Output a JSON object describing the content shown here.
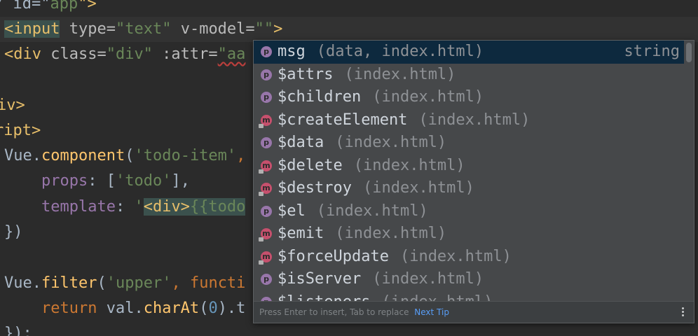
{
  "code_lines": [
    {
      "tokens": [
        {
          "t": "/ id=\"",
          "c": "plain"
        },
        {
          "t": "app",
          "c": "str"
        },
        {
          "t": "\">",
          "c": "tag"
        }
      ]
    },
    {
      "tokens": [
        {
          "t": "<input",
          "c": "tag"
        },
        {
          "t": " type=",
          "c": "attr"
        },
        {
          "t": "\"text\"",
          "c": "str"
        },
        {
          "t": " ",
          "c": "plain"
        },
        {
          "t": "v-model=",
          "c": "attr"
        },
        {
          "t": "\"\"",
          "c": "str"
        },
        {
          "t": ">",
          "c": "tag"
        }
      ]
    },
    {
      "tokens": [
        {
          "t": "<div",
          "c": "tag"
        },
        {
          "t": " class=",
          "c": "attr"
        },
        {
          "t": "\"div\"",
          "c": "str"
        },
        {
          "t": " :attr=",
          "c": "attr"
        },
        {
          "t": "\"aa",
          "c": "str"
        }
      ]
    },
    {
      "tokens": []
    },
    {
      "tokens": [
        {
          "t": "iv>",
          "c": "tag"
        }
      ]
    },
    {
      "tokens": [
        {
          "t": "ript>",
          "c": "tag"
        }
      ]
    },
    {
      "tokens": [
        {
          "t": "Vue",
          "c": "plain"
        },
        {
          "t": ".",
          "c": "plain"
        },
        {
          "t": "component",
          "c": "fn"
        },
        {
          "t": "(",
          "c": "plain"
        },
        {
          "t": "'todo-item'",
          "c": "str"
        },
        {
          "t": ",",
          "c": "kw"
        }
      ]
    },
    {
      "tokens": [
        {
          "t": "    props",
          "c": "prop"
        },
        {
          "t": ": [",
          "c": "plain"
        },
        {
          "t": "'todo'",
          "c": "str"
        },
        {
          "t": "],",
          "c": "plain"
        }
      ]
    },
    {
      "tokens": [
        {
          "t": "    template",
          "c": "prop"
        },
        {
          "t": ": ",
          "c": "plain"
        },
        {
          "t": "'",
          "c": "str"
        },
        {
          "t": "<div>",
          "c": "tag"
        },
        {
          "t": "{{todo",
          "c": "str"
        }
      ]
    },
    {
      "tokens": [
        {
          "t": "})",
          "c": "plain"
        }
      ]
    },
    {
      "tokens": []
    },
    {
      "tokens": [
        {
          "t": "Vue",
          "c": "plain"
        },
        {
          "t": ".",
          "c": "plain"
        },
        {
          "t": "filter",
          "c": "fn"
        },
        {
          "t": "(",
          "c": "plain"
        },
        {
          "t": "'upper'",
          "c": "str"
        },
        {
          "t": ", ",
          "c": "kw"
        },
        {
          "t": "functi",
          "c": "kw"
        }
      ]
    },
    {
      "tokens": [
        {
          "t": "    ",
          "c": "plain"
        },
        {
          "t": "return",
          "c": "kw"
        },
        {
          "t": " val.",
          "c": "plain"
        },
        {
          "t": "charAt",
          "c": "fn"
        },
        {
          "t": "(",
          "c": "plain"
        },
        {
          "t": "0",
          "c": "num"
        },
        {
          "t": ").t",
          "c": "plain"
        }
      ]
    },
    {
      "tokens": [
        {
          "t": "});",
          "c": "plain"
        }
      ]
    }
  ],
  "completion": {
    "items": [
      {
        "kind": "p",
        "name": "msg",
        "loc": "(data, index.html)",
        "type": "string",
        "selected": true
      },
      {
        "kind": "p",
        "name": "$attrs",
        "loc": "(index.html)",
        "type": ""
      },
      {
        "kind": "p",
        "name": "$children",
        "loc": "(index.html)",
        "type": ""
      },
      {
        "kind": "m",
        "name": "$createElement",
        "loc": "(index.html)",
        "type": ""
      },
      {
        "kind": "p",
        "name": "$data",
        "loc": "(index.html)",
        "type": ""
      },
      {
        "kind": "m",
        "name": "$delete",
        "loc": "(index.html)",
        "type": ""
      },
      {
        "kind": "m",
        "name": "$destroy",
        "loc": "(index.html)",
        "type": ""
      },
      {
        "kind": "p",
        "name": "$el",
        "loc": "(index.html)",
        "type": ""
      },
      {
        "kind": "m",
        "name": "$emit",
        "loc": "(index.html)",
        "type": ""
      },
      {
        "kind": "m",
        "name": "$forceUpdate",
        "loc": "(index.html)",
        "type": ""
      },
      {
        "kind": "p",
        "name": "$isServer",
        "loc": "(index.html)",
        "type": ""
      },
      {
        "kind": "p",
        "name": "$listeners",
        "loc": "(index.html)",
        "type": ""
      }
    ],
    "footer_hint": "Press Enter to insert, Tab to replace",
    "footer_link": "Next Tip",
    "menu_icon": "kebab-menu-icon"
  },
  "colors": {
    "background": "#2b2b2b",
    "popup_bg": "#46484a",
    "selection": "#0d293e",
    "property_icon": "#9876aa",
    "method_icon": "#c6506d",
    "link": "#589df6"
  }
}
